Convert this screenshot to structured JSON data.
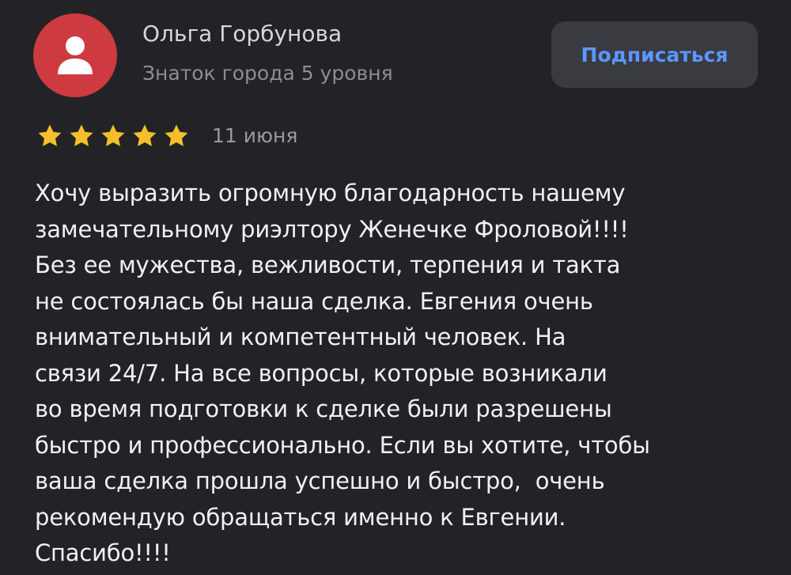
{
  "review": {
    "author": {
      "name": "Ольга Горбунова",
      "level": "Знаток города 5 уровня",
      "avatar_icon": "user-silhouette-icon",
      "avatar_color": "#cd3a3f"
    },
    "subscribe_label": "Подписаться",
    "rating": {
      "value": 5,
      "max": 5,
      "icon": "star-icon",
      "color": "#f4bf2a"
    },
    "date": "11 июня",
    "text_lines": [
      "Хочу выразить огромную благодарность нашему",
      "замечательному риэлтору Женечке Фроловой!!!!",
      "Без ее мужества, вежливости, терпения и такта",
      "не состоялась бы наша сделка. Евгения очень",
      "внимательный и компетентный человек. На",
      "связи 24/7. На все вопросы, которые возникали",
      "во время подготовки к сделке были разрешены",
      "быстро и профессионально. Если вы хотите, чтобы",
      "ваша сделка прошла успешно и быстро,  очень",
      "рекомендую обращаться именно к Евгении.",
      "Спасибо!!!!"
    ]
  },
  "colors": {
    "background": "#232226",
    "accent": "#5a97ff",
    "button_background": "#3a3a41"
  }
}
